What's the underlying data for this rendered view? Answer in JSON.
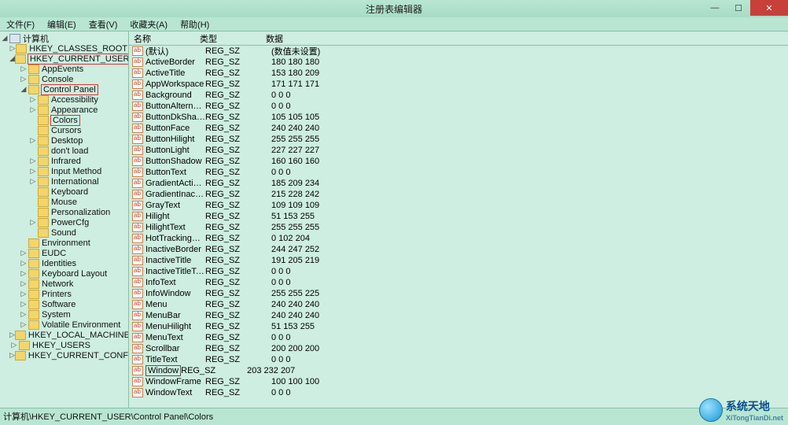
{
  "window": {
    "title": "注册表编辑器",
    "close": "✕",
    "max": "☐",
    "min": "—"
  },
  "menu": [
    "文件(F)",
    "编辑(E)",
    "查看(V)",
    "收藏夹(A)",
    "帮助(H)"
  ],
  "tree_root": "计算机",
  "tree": [
    {
      "label": "HKEY_CLASSES_ROOT",
      "depth": 1,
      "exp": "▷"
    },
    {
      "label": "HKEY_CURRENT_USER",
      "depth": 1,
      "exp": "◢",
      "hl": true
    },
    {
      "label": "AppEvents",
      "depth": 2,
      "exp": "▷"
    },
    {
      "label": "Console",
      "depth": 2,
      "exp": "▷"
    },
    {
      "label": "Control Panel",
      "depth": 2,
      "exp": "◢",
      "hl": true
    },
    {
      "label": "Accessibility",
      "depth": 3,
      "exp": "▷"
    },
    {
      "label": "Appearance",
      "depth": 3,
      "exp": "▷"
    },
    {
      "label": "Colors",
      "depth": 3,
      "exp": "",
      "hl": true
    },
    {
      "label": "Cursors",
      "depth": 3,
      "exp": ""
    },
    {
      "label": "Desktop",
      "depth": 3,
      "exp": "▷"
    },
    {
      "label": "don't load",
      "depth": 3,
      "exp": ""
    },
    {
      "label": "Infrared",
      "depth": 3,
      "exp": "▷"
    },
    {
      "label": "Input Method",
      "depth": 3,
      "exp": "▷"
    },
    {
      "label": "International",
      "depth": 3,
      "exp": "▷"
    },
    {
      "label": "Keyboard",
      "depth": 3,
      "exp": ""
    },
    {
      "label": "Mouse",
      "depth": 3,
      "exp": ""
    },
    {
      "label": "Personalization",
      "depth": 3,
      "exp": ""
    },
    {
      "label": "PowerCfg",
      "depth": 3,
      "exp": "▷"
    },
    {
      "label": "Sound",
      "depth": 3,
      "exp": ""
    },
    {
      "label": "Environment",
      "depth": 2,
      "exp": ""
    },
    {
      "label": "EUDC",
      "depth": 2,
      "exp": "▷"
    },
    {
      "label": "Identities",
      "depth": 2,
      "exp": "▷"
    },
    {
      "label": "Keyboard Layout",
      "depth": 2,
      "exp": "▷"
    },
    {
      "label": "Network",
      "depth": 2,
      "exp": "▷"
    },
    {
      "label": "Printers",
      "depth": 2,
      "exp": "▷"
    },
    {
      "label": "Software",
      "depth": 2,
      "exp": "▷"
    },
    {
      "label": "System",
      "depth": 2,
      "exp": "▷"
    },
    {
      "label": "Volatile Environment",
      "depth": 2,
      "exp": "▷"
    },
    {
      "label": "HKEY_LOCAL_MACHINE",
      "depth": 1,
      "exp": "▷"
    },
    {
      "label": "HKEY_USERS",
      "depth": 1,
      "exp": "▷"
    },
    {
      "label": "HKEY_CURRENT_CONFIG",
      "depth": 1,
      "exp": "▷"
    }
  ],
  "columns": {
    "name": "名称",
    "type": "类型",
    "data": "数据"
  },
  "values": [
    {
      "name": "(默认)",
      "type": "REG_SZ",
      "data": "(数值未设置)"
    },
    {
      "name": "ActiveBorder",
      "type": "REG_SZ",
      "data": "180 180 180"
    },
    {
      "name": "ActiveTitle",
      "type": "REG_SZ",
      "data": "153 180 209"
    },
    {
      "name": "AppWorkspace",
      "type": "REG_SZ",
      "data": "171 171 171"
    },
    {
      "name": "Background",
      "type": "REG_SZ",
      "data": "0 0 0"
    },
    {
      "name": "ButtonAlternat...",
      "type": "REG_SZ",
      "data": "0 0 0"
    },
    {
      "name": "ButtonDkShad...",
      "type": "REG_SZ",
      "data": "105 105 105"
    },
    {
      "name": "ButtonFace",
      "type": "REG_SZ",
      "data": "240 240 240"
    },
    {
      "name": "ButtonHilight",
      "type": "REG_SZ",
      "data": "255 255 255"
    },
    {
      "name": "ButtonLight",
      "type": "REG_SZ",
      "data": "227 227 227"
    },
    {
      "name": "ButtonShadow",
      "type": "REG_SZ",
      "data": "160 160 160"
    },
    {
      "name": "ButtonText",
      "type": "REG_SZ",
      "data": "0 0 0"
    },
    {
      "name": "GradientActive...",
      "type": "REG_SZ",
      "data": "185 209 234"
    },
    {
      "name": "GradientInactiv...",
      "type": "REG_SZ",
      "data": "215 228 242"
    },
    {
      "name": "GrayText",
      "type": "REG_SZ",
      "data": "109 109 109"
    },
    {
      "name": "Hilight",
      "type": "REG_SZ",
      "data": "51 153 255"
    },
    {
      "name": "HilightText",
      "type": "REG_SZ",
      "data": "255 255 255"
    },
    {
      "name": "HotTrackingCo...",
      "type": "REG_SZ",
      "data": "0 102 204"
    },
    {
      "name": "InactiveBorder",
      "type": "REG_SZ",
      "data": "244 247 252"
    },
    {
      "name": "InactiveTitle",
      "type": "REG_SZ",
      "data": "191 205 219"
    },
    {
      "name": "InactiveTitleText",
      "type": "REG_SZ",
      "data": "0 0 0"
    },
    {
      "name": "InfoText",
      "type": "REG_SZ",
      "data": "0 0 0"
    },
    {
      "name": "InfoWindow",
      "type": "REG_SZ",
      "data": "255 255 225"
    },
    {
      "name": "Menu",
      "type": "REG_SZ",
      "data": "240 240 240"
    },
    {
      "name": "MenuBar",
      "type": "REG_SZ",
      "data": "240 240 240"
    },
    {
      "name": "MenuHilight",
      "type": "REG_SZ",
      "data": "51 153 255"
    },
    {
      "name": "MenuText",
      "type": "REG_SZ",
      "data": "0 0 0"
    },
    {
      "name": "Scrollbar",
      "type": "REG_SZ",
      "data": "200 200 200"
    },
    {
      "name": "TitleText",
      "type": "REG_SZ",
      "data": "0 0 0"
    },
    {
      "name": "Window",
      "type": "REG_SZ",
      "data": "203 232 207",
      "boxed": true
    },
    {
      "name": "WindowFrame",
      "type": "REG_SZ",
      "data": "100 100 100"
    },
    {
      "name": "WindowText",
      "type": "REG_SZ",
      "data": "0 0 0"
    }
  ],
  "statusbar": "计算机\\HKEY_CURRENT_USER\\Control Panel\\Colors",
  "watermark": {
    "cn": "系统天地",
    "en": "XiTongTianDi.net"
  }
}
